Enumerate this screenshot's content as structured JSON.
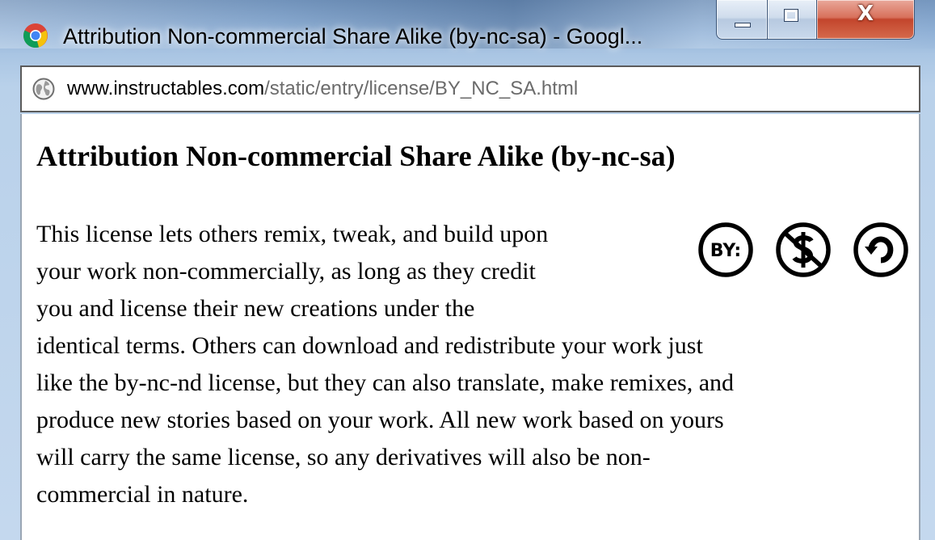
{
  "window": {
    "title": "Attribution Non-commercial Share Alike (by-nc-sa) - Googl...",
    "controls": {
      "minimize": "minimize",
      "maximize": "maximize",
      "close": "close"
    }
  },
  "address_bar": {
    "host": "www.instructables.com",
    "path": "/static/entry/license/BY_NC_SA.html"
  },
  "page": {
    "heading": "Attribution Non-commercial Share Alike (by-nc-sa)",
    "paragraph_lines": [
      "This license lets others remix, tweak, and build upon",
      "your work non-commercially, as long as they credit",
      "you and license their new creations under the",
      "identical terms. Others can download and redistribute your work just",
      "like the by-nc-nd license, but they can also translate, make remixes, and",
      "produce new stories based on your work. All new work based on yours",
      "will carry the same license, so any derivatives will also be non-",
      "commercial in nature."
    ],
    "license_icons": {
      "by_label": "BY:",
      "icons": [
        "by-attribution-icon",
        "non-commercial-icon",
        "share-alike-icon"
      ]
    }
  },
  "colors": {
    "close_button": "#c3452c",
    "url_path": "#6b6b6b",
    "frame_border": "#3b5578"
  }
}
